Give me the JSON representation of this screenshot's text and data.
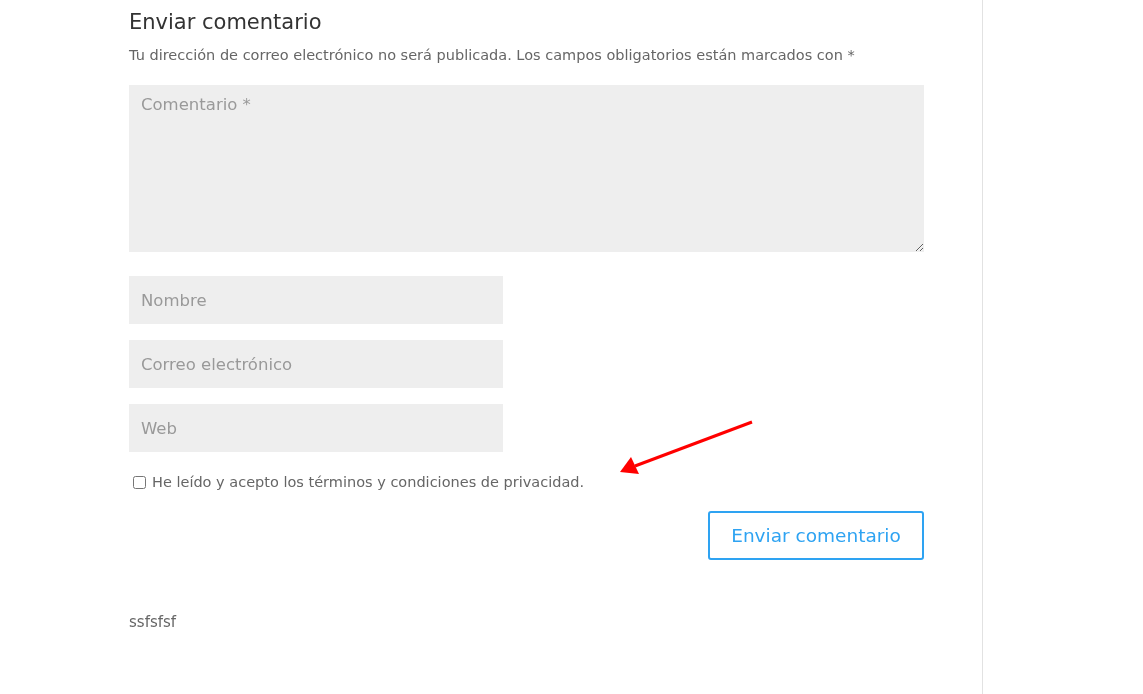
{
  "heading": "Enviar comentario",
  "note": "Tu dirección de correo electrónico no será publicada. Los campos obligatorios están marcados con *",
  "comment_field": {
    "placeholder": "Comentario *"
  },
  "fields": [
    {
      "placeholder": "Nombre"
    },
    {
      "placeholder": "Correo electrónico"
    },
    {
      "placeholder": "Web"
    }
  ],
  "consent": {
    "label": "He leído y acepto los términos y condiciones de privacidad.",
    "checked": false
  },
  "submit_button": "Enviar comentario",
  "comment_text": "ssfsfsf"
}
